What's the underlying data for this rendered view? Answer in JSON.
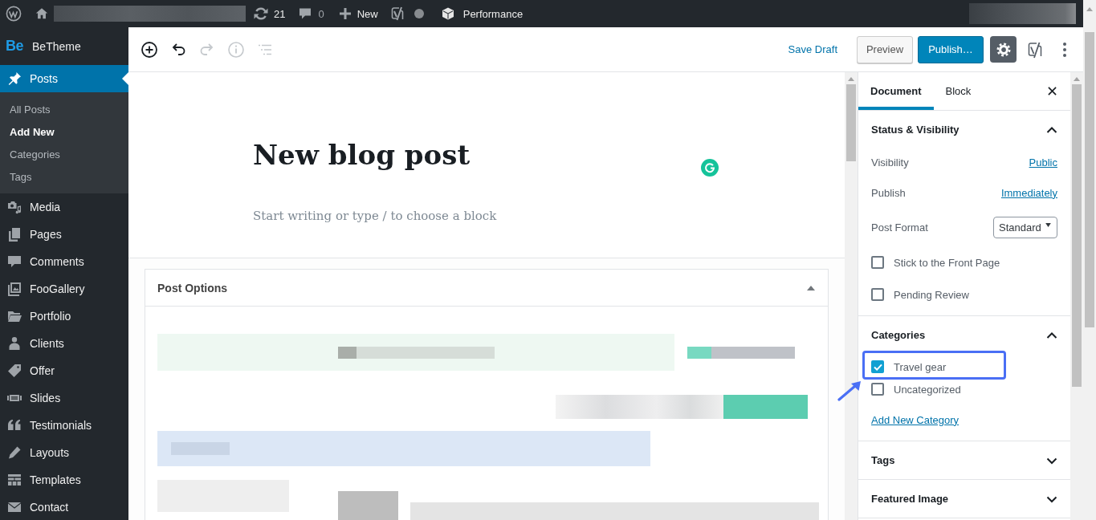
{
  "admin_bar": {
    "updates_count": "21",
    "comments_count": "0",
    "new_label": "New",
    "performance_label": "Performance"
  },
  "admin_menu": {
    "brand": {
      "logo": "Be",
      "name": "BeTheme"
    },
    "items": [
      {
        "label": "Posts",
        "selected": true,
        "children": [
          {
            "label": "All Posts",
            "selected": false
          },
          {
            "label": "Add New",
            "selected": true
          },
          {
            "label": "Categories",
            "selected": false
          },
          {
            "label": "Tags",
            "selected": false
          }
        ]
      },
      {
        "label": "Media",
        "selected": false
      },
      {
        "label": "Pages",
        "selected": false
      },
      {
        "label": "Comments",
        "selected": false
      },
      {
        "label": "FooGallery",
        "selected": false
      },
      {
        "label": "Portfolio",
        "selected": false
      },
      {
        "label": "Clients",
        "selected": false
      },
      {
        "label": "Offer",
        "selected": false
      },
      {
        "label": "Slides",
        "selected": false
      },
      {
        "label": "Testimonials",
        "selected": false
      },
      {
        "label": "Layouts",
        "selected": false
      },
      {
        "label": "Templates",
        "selected": false
      },
      {
        "label": "Contact",
        "selected": false
      }
    ]
  },
  "editor_header": {
    "tools": [
      {
        "kind": "add",
        "disabled": false
      },
      {
        "kind": "undo",
        "disabled": false
      },
      {
        "kind": "redo",
        "disabled": true
      },
      {
        "kind": "info",
        "disabled": true
      },
      {
        "kind": "outline",
        "disabled": true
      }
    ],
    "save_draft": "Save Draft",
    "preview": "Preview",
    "publish": "Publish…",
    "settings": {
      "selected": true
    }
  },
  "editor": {
    "title": "New blog post",
    "placeholder": "Start writing or type / to choose a block"
  },
  "metabox": {
    "title": "Post Options",
    "expanded": true
  },
  "sidebar": {
    "tabs": [
      {
        "label": "Document",
        "selected": true
      },
      {
        "label": "Block",
        "selected": false
      }
    ],
    "panels": [
      {
        "title": "Status & Visibility",
        "expanded": true,
        "rows": [
          {
            "kind": "link",
            "label": "Visibility",
            "value": "Public"
          },
          {
            "kind": "link",
            "label": "Publish",
            "value": "Immediately"
          },
          {
            "kind": "select",
            "label": "Post Format",
            "value": "Standard"
          },
          {
            "kind": "checkbox",
            "label": "Stick to the Front Page",
            "checked": false,
            "highlighted": false
          },
          {
            "kind": "checkbox",
            "label": "Pending Review",
            "checked": false,
            "highlighted": false
          }
        ]
      },
      {
        "title": "Categories",
        "expanded": true,
        "rows": [
          {
            "kind": "checkbox",
            "label": "Travel gear",
            "checked": true,
            "highlighted": true
          },
          {
            "kind": "checkbox",
            "label": "Uncategorized",
            "checked": false,
            "highlighted": false
          },
          {
            "kind": "action",
            "label": "Add New Category"
          }
        ]
      },
      {
        "title": "Tags",
        "expanded": false
      },
      {
        "title": "Featured Image",
        "expanded": false
      }
    ]
  }
}
